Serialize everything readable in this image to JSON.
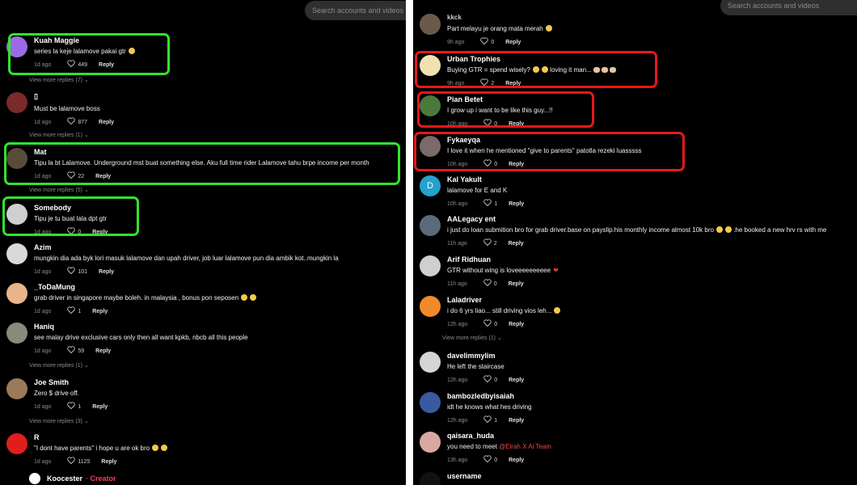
{
  "search": {
    "placeholder": "Search accounts and videos"
  },
  "left": {
    "comments": [
      {
        "username": "Kuah Maggie",
        "text": "series la keje lalamove pakai gtr",
        "time": "1d ago",
        "likes": "449",
        "reply": "Reply",
        "more": "View more replies (7)"
      },
      {
        "username": "▯",
        "text": "Must be lalamove boss",
        "time": "1d ago",
        "likes": "877",
        "reply": "Reply",
        "more": "View more replies (1)"
      },
      {
        "username": "Mat",
        "text": "Tipu la bt Lalamove. Underground mst buat something else. Aku full time rider Lalamove tahu brpe income per month",
        "time": "1d ago",
        "likes": "22",
        "reply": "Reply",
        "more": "View more replies (5)"
      },
      {
        "username": "Somebody",
        "text": "Tipu je tu buat lala dpt gtr",
        "time": "1d ago",
        "likes": "0",
        "reply": "Reply"
      },
      {
        "username": "Azim",
        "text": "mungkin dia ada byk lori masuk lalamove dan upah driver, job luar lalamove pun dia ambik kot..mungkin la",
        "time": "1d ago",
        "likes": "101",
        "reply": "Reply"
      },
      {
        "username": "_ToDaMung",
        "text": "grab driver in singapore maybe boleh. in malaysia , bonus pon seposen",
        "time": "1d ago",
        "likes": "1",
        "reply": "Reply"
      },
      {
        "username": "Haniq",
        "text": "see malay drive exclusive cars only then all want kpkb, nbcb all this people",
        "time": "1d ago",
        "likes": "59",
        "reply": "Reply",
        "more": "View more replies (1)"
      },
      {
        "username": "Joe Smith",
        "text": "Zero $ drive off.",
        "time": "1d ago",
        "likes": "1",
        "reply": "Reply",
        "more": "View more replies (3)"
      },
      {
        "username": "R",
        "text": "\"I dont have parents\" i hope u are ok bro",
        "time": "1d ago",
        "likes": "1125",
        "reply": "Reply"
      },
      {
        "username": "Koocester",
        "creator": "· Creator"
      }
    ]
  },
  "right": {
    "top_name": "kkck",
    "comments": [
      {
        "username": "kkck",
        "text": "Part melayu je orang mata merah",
        "time": "9h ago",
        "likes": "0",
        "reply": "Reply"
      },
      {
        "username": "Urban Trophies",
        "text": "Buying GTR = spend wisely?",
        "text2": "loving it man...",
        "time": "9h ago",
        "likes": "2",
        "reply": "Reply"
      },
      {
        "username": "Pian Betet",
        "text": "I grow up i want to be like this guy...!!",
        "time": "10h ago",
        "likes": "0",
        "reply": "Reply"
      },
      {
        "username": "Fykaeyqa",
        "text": "I love it when he mentioned \"give to parents\" patotla rezeki luasssss",
        "time": "10h ago",
        "likes": "0",
        "reply": "Reply"
      },
      {
        "username": "Kal Yakult",
        "avatar_letter": "D",
        "text": "lalamove for E and K",
        "time": "10h ago",
        "likes": "1",
        "reply": "Reply"
      },
      {
        "username": "AALegacy ent",
        "text": "i just do loan submition bro for grab driver.base on payslip.his monthly income almost 10k bro",
        "text2": ".he booked a new hrv rs with me",
        "time": "11h ago",
        "likes": "2",
        "reply": "Reply"
      },
      {
        "username": "Arif Ridhuan",
        "text": "GTR without wing is loveeeeeeeeee",
        "time": "11h ago",
        "likes": "0",
        "reply": "Reply"
      },
      {
        "username": "Laladriver",
        "text": "i do 6 yrs liao... still driving vios leh...",
        "time": "12h ago",
        "likes": "0",
        "reply": "Reply",
        "more": "View more replies (1)"
      },
      {
        "username": "davelimmylim",
        "text": "He left the staircase",
        "time": "12h ago",
        "likes": "0",
        "reply": "Reply"
      },
      {
        "username": "bambozledbyisaiah",
        "text": "idt he knows what hes driving",
        "time": "12h ago",
        "likes": "1",
        "reply": "Reply"
      },
      {
        "username": "qaisara_huda",
        "text": "you need to meet",
        "mention": "@Elrah X Ai Team",
        "time": "13h ago",
        "likes": "0",
        "reply": "Reply"
      },
      {
        "username": "username"
      }
    ]
  },
  "colors": {
    "green_highlight": "#31e32d",
    "red_highlight": "#e81818",
    "creator": "#ff3b5c"
  }
}
